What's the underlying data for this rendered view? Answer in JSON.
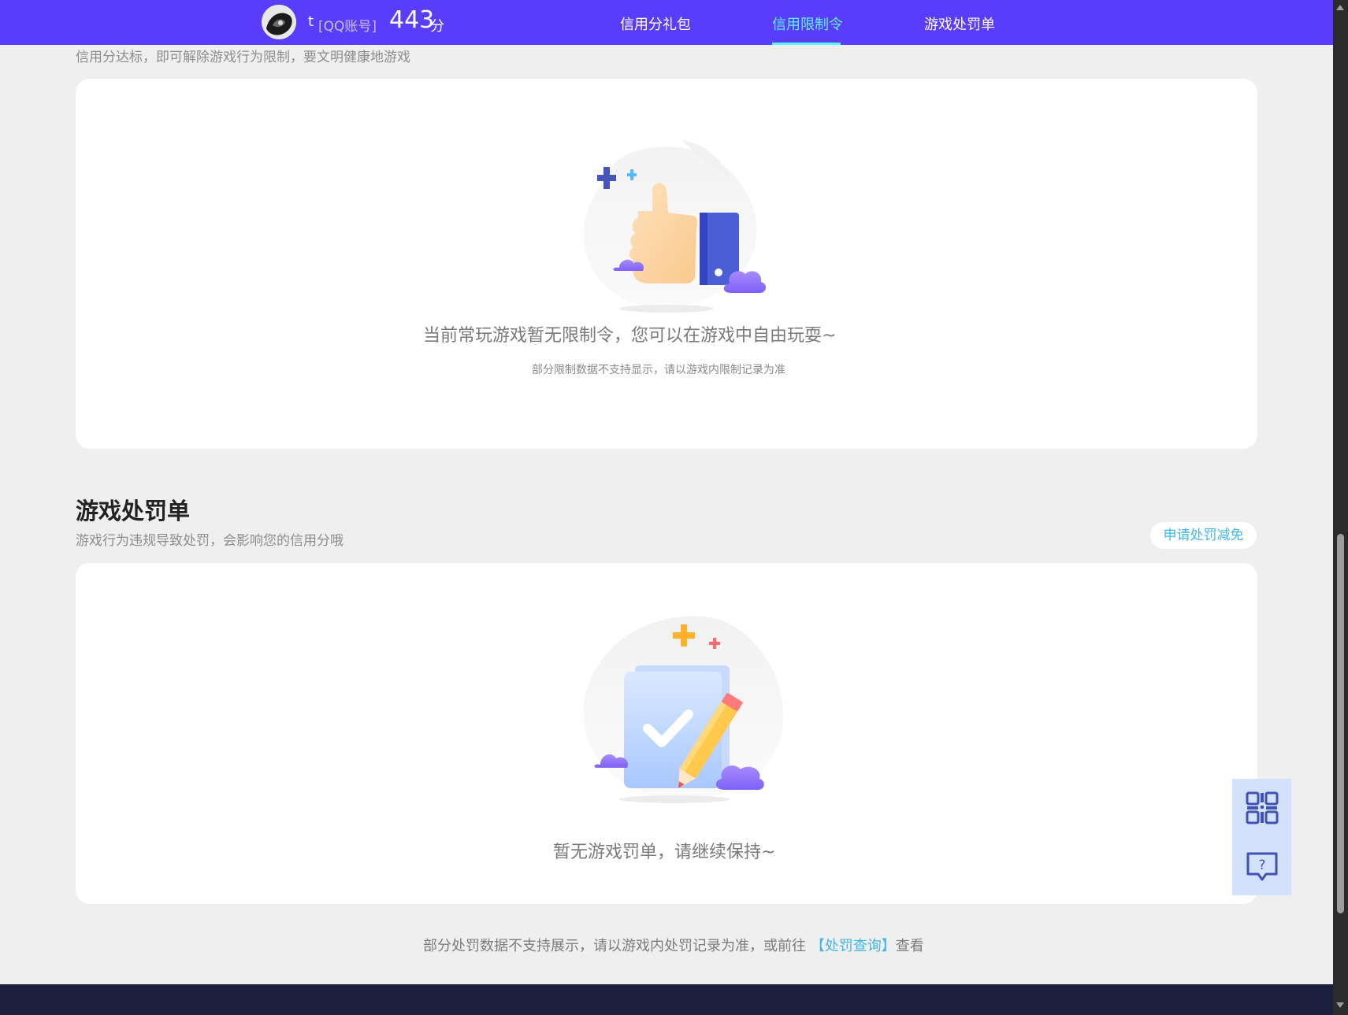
{
  "header": {
    "user_name": "t",
    "account_type": "[QQ账号]",
    "score": "443",
    "score_unit": "分",
    "tabs": [
      {
        "label": "信用分礼包",
        "active": false
      },
      {
        "label": "信用限制令",
        "active": true
      },
      {
        "label": "游戏处罚单",
        "active": false
      }
    ]
  },
  "restriction": {
    "subtitle": "信用分达标，即可解除游戏行为限制，要文明健康地游戏",
    "empty_message": "当前常玩游戏暂无限制令，您可以在游戏中自由玩耍~",
    "note": "部分限制数据不支持显示，请以游戏内限制记录为准"
  },
  "penalty": {
    "title": "游戏处罚单",
    "subtitle": "游戏行为违规导致处罚，会影响您的信用分哦",
    "appeal_button": "申请处罚减免",
    "empty_message": "暂无游戏罚单，请继续保持~"
  },
  "footer": {
    "note_prefix": "部分处罚数据不支持展示，请以游戏内处罚记录为准，或前往",
    "link": "【处罚查询】",
    "note_suffix": "查看"
  },
  "colors": {
    "nav_bg": "#5a3dfb",
    "active_tab": "#5ff2ff",
    "link": "#3fb6ea",
    "page_bg": "#efefef",
    "bottom_bar": "#1c1e3e"
  },
  "icons": {
    "qr": "qr-code-icon",
    "help": "help-chat-icon"
  }
}
